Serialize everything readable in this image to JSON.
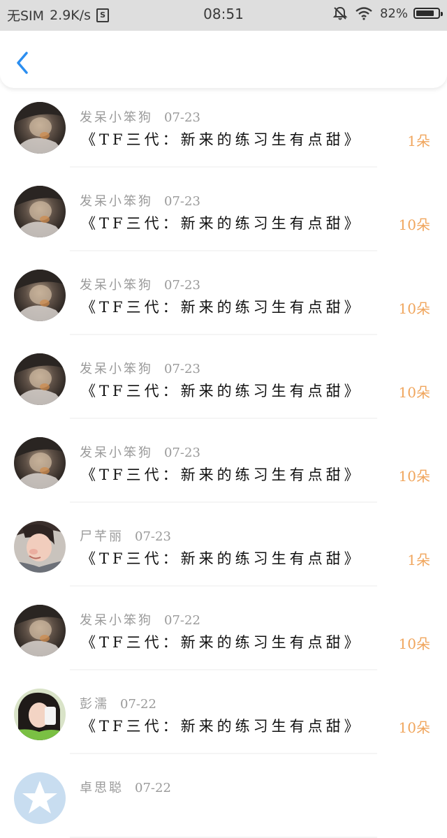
{
  "status_bar": {
    "carrier": "无SIM",
    "speed": "2.9K/s",
    "sim_icon_text": "S",
    "time": "08:51",
    "battery": "82%",
    "battery_level": 0.82,
    "icons": [
      "sim-s-icon",
      "mute-bell-icon",
      "wifi-icon",
      "battery-icon"
    ]
  },
  "nav": {
    "back_icon": "chevron-left-icon",
    "accent_color": "#2b8ef0"
  },
  "colors": {
    "sender": "#9a9a9a",
    "title": "#111111",
    "amount": "#f0a55c"
  },
  "gifts": [
    {
      "sender": "发呆小笨狗",
      "date": "07-23",
      "title": "《TF三代：新来的练习生有点甜》",
      "amount": "1朵",
      "avatar": "avatar-dark"
    },
    {
      "sender": "发呆小笨狗",
      "date": "07-23",
      "title": "《TF三代：新来的练习生有点甜》",
      "amount": "10朵",
      "avatar": "avatar-dark"
    },
    {
      "sender": "发呆小笨狗",
      "date": "07-23",
      "title": "《TF三代：新来的练习生有点甜》",
      "amount": "10朵",
      "avatar": "avatar-dark"
    },
    {
      "sender": "发呆小笨狗",
      "date": "07-23",
      "title": "《TF三代：新来的练习生有点甜》",
      "amount": "10朵",
      "avatar": "avatar-dark"
    },
    {
      "sender": "发呆小笨狗",
      "date": "07-23",
      "title": "《TF三代：新来的练习生有点甜》",
      "amount": "10朵",
      "avatar": "avatar-dark"
    },
    {
      "sender": "尸芊丽",
      "date": "07-23",
      "title": "《TF三代：新来的练习生有点甜》",
      "amount": "1朵",
      "avatar": "avatar-boy"
    },
    {
      "sender": "发呆小笨狗",
      "date": "07-22",
      "title": "《TF三代：新来的练习生有点甜》",
      "amount": "10朵",
      "avatar": "avatar-dark"
    },
    {
      "sender": "彭濡",
      "date": "07-22",
      "title": "《TF三代：新来的练习生有点甜》",
      "amount": "10朵",
      "avatar": "avatar-girl"
    },
    {
      "sender": "卓思聪",
      "date": "07-22",
      "title": "",
      "amount": "",
      "avatar": "avatar-default"
    }
  ]
}
